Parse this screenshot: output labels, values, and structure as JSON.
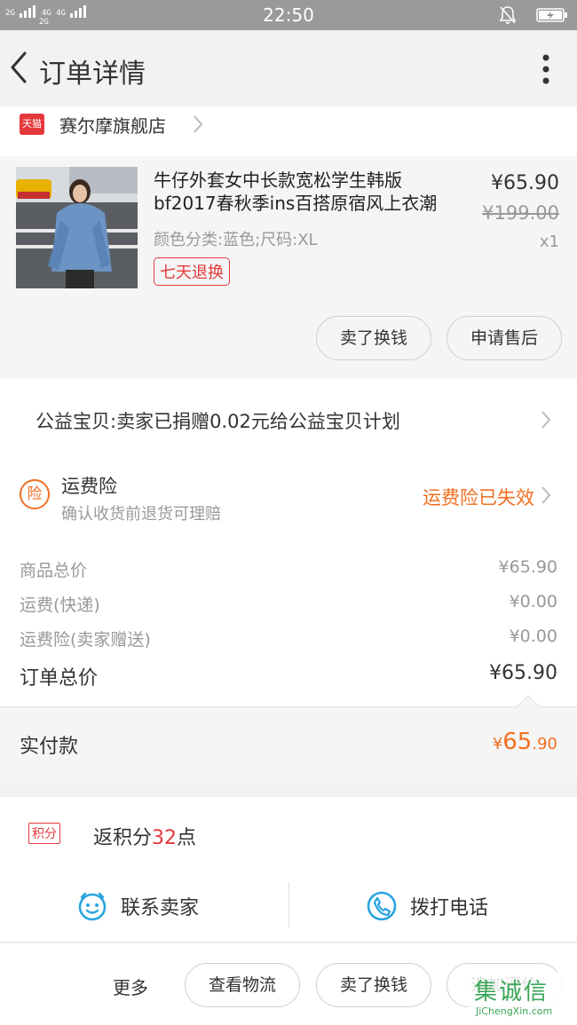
{
  "status_bar": {
    "signal_top": "2G",
    "signal_mid": "4G 4G",
    "signal_mid2": "2G",
    "time": "22:50"
  },
  "header": {
    "title": "订单详情"
  },
  "shop": {
    "badge": "天猫",
    "name": "赛尔摩旗舰店"
  },
  "product": {
    "title_line1": "牛仔外套女中长款宽松学生韩版",
    "title_line2": "bf2017春秋季ins百搭原宿风上衣潮",
    "spec": "颜色分类:蓝色;尺码:XL",
    "return_badge": "七天退换",
    "price": "¥65.90",
    "original_price": "¥199.00",
    "quantity": "x1",
    "actions": [
      "卖了换钱",
      "申请售后"
    ]
  },
  "charity": {
    "text": "公益宝贝:卖家已捐赠0.02元给公益宝贝计划"
  },
  "insurance": {
    "icon_text": "险",
    "title": "运费险",
    "subtitle": "确认收货前退货可理赔",
    "status": "运费险已失效"
  },
  "price_details": {
    "rows": [
      {
        "label": "商品总价",
        "value": "¥65.90"
      },
      {
        "label": "运费(快递)",
        "value": "¥0.00"
      },
      {
        "label": "运费险(卖家赠送)",
        "value": "¥0.00"
      }
    ],
    "total_label": "订单总价",
    "total_value": "¥65.90"
  },
  "paid": {
    "label": "实付款",
    "symbol": "¥",
    "integer": "65",
    "decimal": ".90"
  },
  "points": {
    "badge": "积分",
    "prefix": "返积分",
    "count": "32",
    "suffix": "点"
  },
  "contact": {
    "seller_label": "联系卖家",
    "phone_label": "拨打电话"
  },
  "bottom_bar": {
    "more_label": "更多",
    "buttons": [
      "查看物流",
      "卖了换钱",
      "追加评价"
    ]
  },
  "watermark": {
    "top": "集诚信",
    "bottom": "JiChengXin.com"
  },
  "colors": {
    "accent_orange": "#f26f21",
    "tmall_red": "#e4393c",
    "status_bar": "#9a9a9a",
    "watermark_green": "#3aa657"
  }
}
